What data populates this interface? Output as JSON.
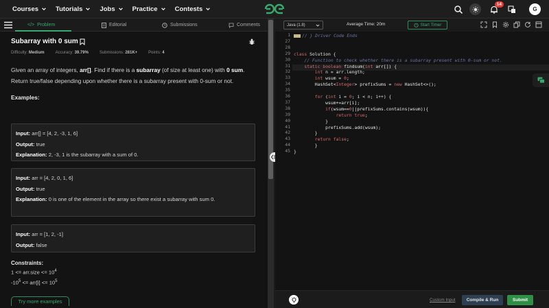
{
  "nav": {
    "items": [
      "Courses",
      "Tutorials",
      "Jobs",
      "Practice",
      "Contests"
    ],
    "notification_count": "14",
    "avatar_initial": "G"
  },
  "tabs": {
    "problem": "Problem",
    "editorial": "Editorial",
    "submissions": "Submissions",
    "comments": "Comments"
  },
  "problem": {
    "title": "Subarray with 0 sum",
    "difficulty_label": "Difficulty:",
    "difficulty": "Medium",
    "accuracy_label": "Accuracy:",
    "accuracy": "39.79%",
    "submissions_label": "Submissions:",
    "submissions": "281K+",
    "points_label": "Points:",
    "points": "4",
    "desc_1": "Given an array of integers, ",
    "desc_arr": "arr[]",
    "desc_2": ". Find if there is a ",
    "desc_subarray": "subarray",
    "desc_3": " (of size at least one) with ",
    "desc_0sum": "0 sum",
    "desc_4": ". Return true/false depending upon whether there is a subarray present with 0-sum or not.",
    "examples_label": "Examples:",
    "examples": [
      {
        "input": "arr[] = [4, 2, -3, 1, 6]",
        "output": "true",
        "explanation": "2, -3, 1 is the subarray with a sum of 0."
      },
      {
        "input": "arr = [4, 2, 0, 1, 6]",
        "output": "true",
        "explanation": "0 is one of the element in the array so there exist a subarray with sum 0."
      },
      {
        "input": "arr = [1, 2, -1]",
        "output": "false"
      }
    ],
    "input_label": "Input:",
    "output_label": "Output:",
    "explanation_label": "Explanation:",
    "constraints_label": "Constraints:",
    "constraint_1_a": "1 <= arr.size <= 10",
    "constraint_1_sup": "4",
    "constraint_2_a": "-10",
    "constraint_2_sup1": "5",
    "constraint_2_b": " <= arr[i] <= 10",
    "constraint_2_sup2": "5",
    "try_more": "Try more examples"
  },
  "editor": {
    "language": "Java (1.8)",
    "average_time": "Average Time: 20m",
    "start_timer": "Start Timer",
    "collapsed_text": "// } Driver Code Ends",
    "line_numbers": [
      "1",
      "27",
      "28",
      "29",
      "30",
      "31",
      "32",
      "33",
      "34",
      "35",
      "36",
      "37",
      "38",
      "39",
      "40",
      "41",
      "42",
      "43",
      "44",
      "45"
    ]
  },
  "bottom": {
    "custom_input": "Custom Input",
    "compile_run": "Compile & Run",
    "submit": "Submit"
  },
  "colors": {
    "accent_green": "#3aa76d",
    "keyword_red": "#d46a6a",
    "comment_blue": "#6b76a6"
  }
}
